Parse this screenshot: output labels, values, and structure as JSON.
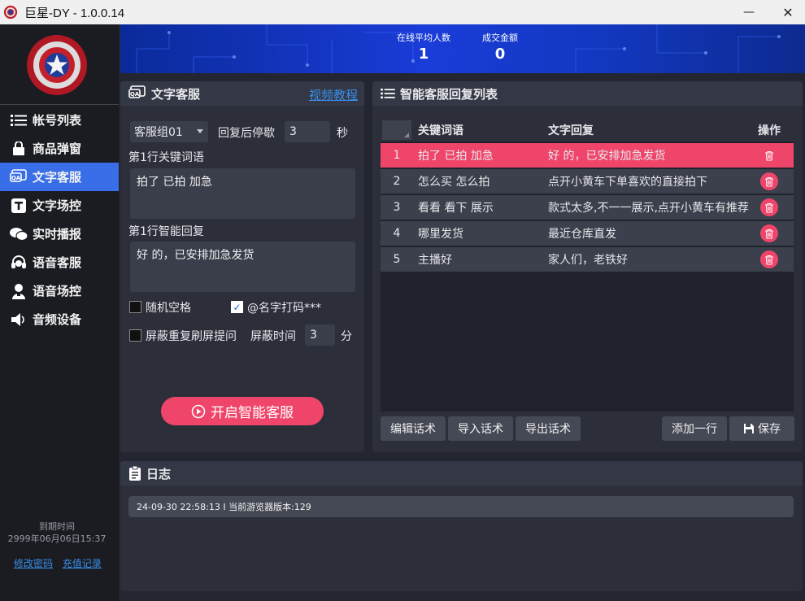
{
  "window": {
    "title": "巨星-DY - 1.0.0.14",
    "minimize_glyph": "—",
    "close_glyph": "✕"
  },
  "sidebar": {
    "items": [
      {
        "label": "帐号列表",
        "icon": "list-icon"
      },
      {
        "label": "商品弹窗",
        "icon": "bag-icon"
      },
      {
        "label": "文字客服",
        "icon": "qa-icon",
        "active": true
      },
      {
        "label": "文字场控",
        "icon": "text-t-icon"
      },
      {
        "label": "实时播报",
        "icon": "chat-bubbles-icon"
      },
      {
        "label": "语音客服",
        "icon": "headset-icon"
      },
      {
        "label": "语音场控",
        "icon": "person-mic-icon"
      },
      {
        "label": "音频设备",
        "icon": "speaker-icon"
      }
    ],
    "expire_label": "到期时间",
    "expire_value": "2999年06月06日15:37",
    "change_password": "修改密码",
    "recharge_record": "充值记录"
  },
  "banner": {
    "online_label": "在线平均人数",
    "online_value": "1",
    "deal_label": "成交金额",
    "deal_value": "0"
  },
  "text_service": {
    "title": "文字客服",
    "tutorial": "视频教程",
    "group_select": "客服组01",
    "stop_label": "回复后停歇",
    "stop_value": "3",
    "sec_label": "秒",
    "keyword_label": "第1行关键词语",
    "keyword_value": "拍了 已拍 加急",
    "reply_label": "第1行智能回复",
    "reply_value": "好 的，已安排加急发货",
    "random_space": "随机空格",
    "random_space_checked": false,
    "name_mask": "@名字打码***",
    "name_mask_checked": true,
    "block_label": "屏蔽重复刷屏提问",
    "block_checked": false,
    "block_time_label": "屏蔽时间",
    "block_time_value": "3",
    "block_unit": "分",
    "start_button": "开启智能客服"
  },
  "reply_list": {
    "title": "智能客服回复列表",
    "columns": {
      "keyword": "关键词语",
      "reply": "文字回复",
      "op": "操作"
    },
    "rows": [
      {
        "num": "1",
        "keyword": "拍了 已拍 加急",
        "reply": "好 的，已安排加急发货"
      },
      {
        "num": "2",
        "keyword": "怎么买 怎么拍",
        "reply": "点开小黄车下单喜欢的直接拍下"
      },
      {
        "num": "3",
        "keyword": "看看 看下 展示",
        "reply": "款式太多,不一一展示,点开小黄车有推荐"
      },
      {
        "num": "4",
        "keyword": "哪里发货",
        "reply": "最近仓库直发"
      },
      {
        "num": "5",
        "keyword": "主播好",
        "reply": "家人们，老铁好"
      }
    ],
    "buttons": {
      "edit": "编辑话术",
      "import": "导入话术",
      "export": "导出话术",
      "add": "添加一行",
      "save": "保存"
    }
  },
  "log": {
    "title": "日志",
    "lines": [
      "24-09-30 22:58:13 I  当前游览器版本:129"
    ]
  },
  "colors": {
    "accent": "#f0456a",
    "active_nav": "#3a6ee8",
    "link": "#3a8ee8"
  }
}
